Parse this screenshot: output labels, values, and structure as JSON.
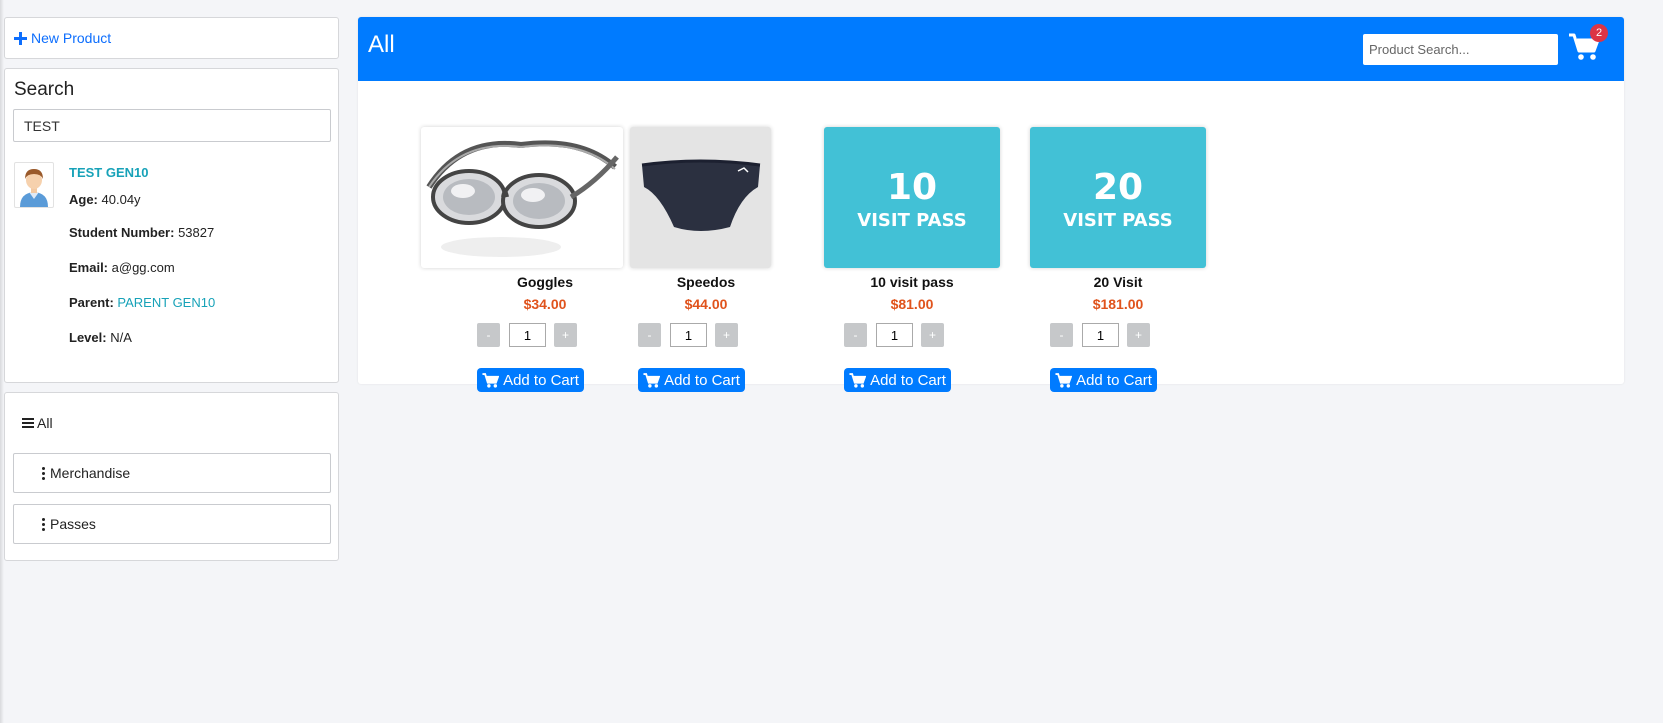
{
  "sidebar": {
    "new_product_label": "New Product",
    "search": {
      "heading": "Search",
      "value": "TEST"
    },
    "student": {
      "name": "TEST GEN10",
      "age_label": "Age:",
      "age_value": "40.04y",
      "student_number_label": "Student Number:",
      "student_number_value": "53827",
      "email_label": "Email:",
      "email_value": "a@gg.com",
      "parent_label": "Parent:",
      "parent_value": "PARENT GEN10",
      "level_label": "Level:",
      "level_value": "N/A"
    },
    "categories": {
      "all_label": "All",
      "items": [
        {
          "label": "Merchandise"
        },
        {
          "label": "Passes"
        }
      ]
    }
  },
  "main": {
    "category_title": "All",
    "search_placeholder": "Product Search...",
    "cart_count": "2",
    "add_to_cart_label": "Add to Cart",
    "minus_label": "-",
    "plus_label": "+",
    "products": [
      {
        "name": "Goggles",
        "price": "$34.00",
        "qty": "1"
      },
      {
        "name": "Speedos",
        "price": "$44.00",
        "qty": "1"
      },
      {
        "name": "10 visit pass",
        "price": "$81.00",
        "qty": "1",
        "image_number": "10",
        "image_text": "VISIT PASS"
      },
      {
        "name": "20 Visit",
        "price": "$181.00",
        "qty": "1",
        "image_number": "20",
        "image_text": "VISIT PASS"
      }
    ]
  },
  "colors": {
    "header": "#007bff",
    "price": "#e0531c",
    "link": "#17a2b8",
    "pass_tile": "#42c1d6",
    "badge": "#dc3545"
  }
}
